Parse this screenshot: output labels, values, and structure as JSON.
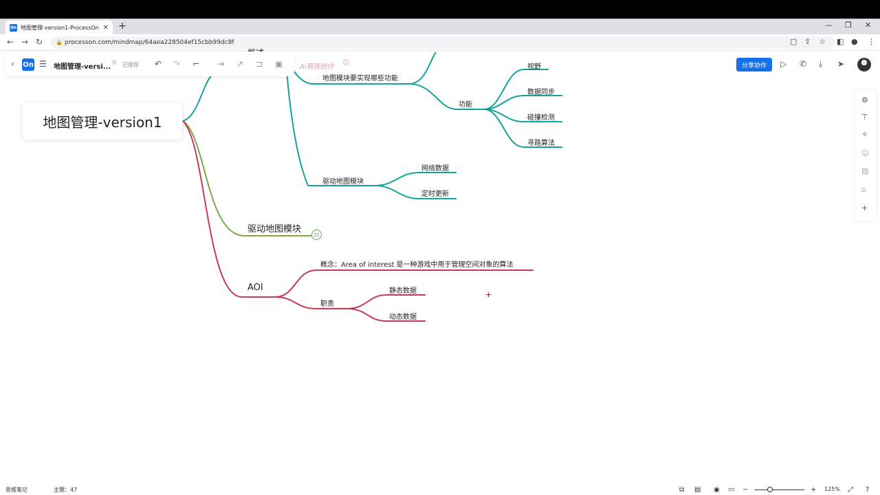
{
  "browser": {
    "tab_title": "地图管理-version1-ProcessOn",
    "favicon_text": "On",
    "tab_close": "✕",
    "new_tab": "+",
    "url": "processon.com/mindmap/64aea228504ef15cbb99dc8f"
  },
  "toolbar": {
    "logo_text": "On",
    "doc_title": "地图管理-versi...",
    "saved_status": "已保存",
    "ai_label": "Ai帮我创作",
    "share_label": "分享协作"
  },
  "mindmap": {
    "root": "地图管理-version1",
    "partial_top": "概述",
    "map_func_question": "地图模块要实现哪些功能",
    "function": "功能",
    "func_items": [
      "视野",
      "数据同步",
      "碰撞检测",
      "寻路算法"
    ],
    "drive_sub": "驱动地图模块",
    "drive_items": [
      "网络数据",
      "定时更新"
    ],
    "drive_main": "驱动地图模块",
    "collapsed_count": "22",
    "aoi": "AOI",
    "aoi_concept": "概念：Area of interest  是一种游戏中用于管理空间对象的算法",
    "aoi_duty": "职责",
    "aoi_duty_items": [
      "静态数据",
      "动态数据"
    ]
  },
  "colors": {
    "teal": "#14a39a",
    "green": "#7aa84a",
    "crimson": "#c53a5a",
    "accent": "#1570ef"
  },
  "status": {
    "mode": "思维笔记",
    "topic_count": "主题：47",
    "zoom": "125%"
  }
}
